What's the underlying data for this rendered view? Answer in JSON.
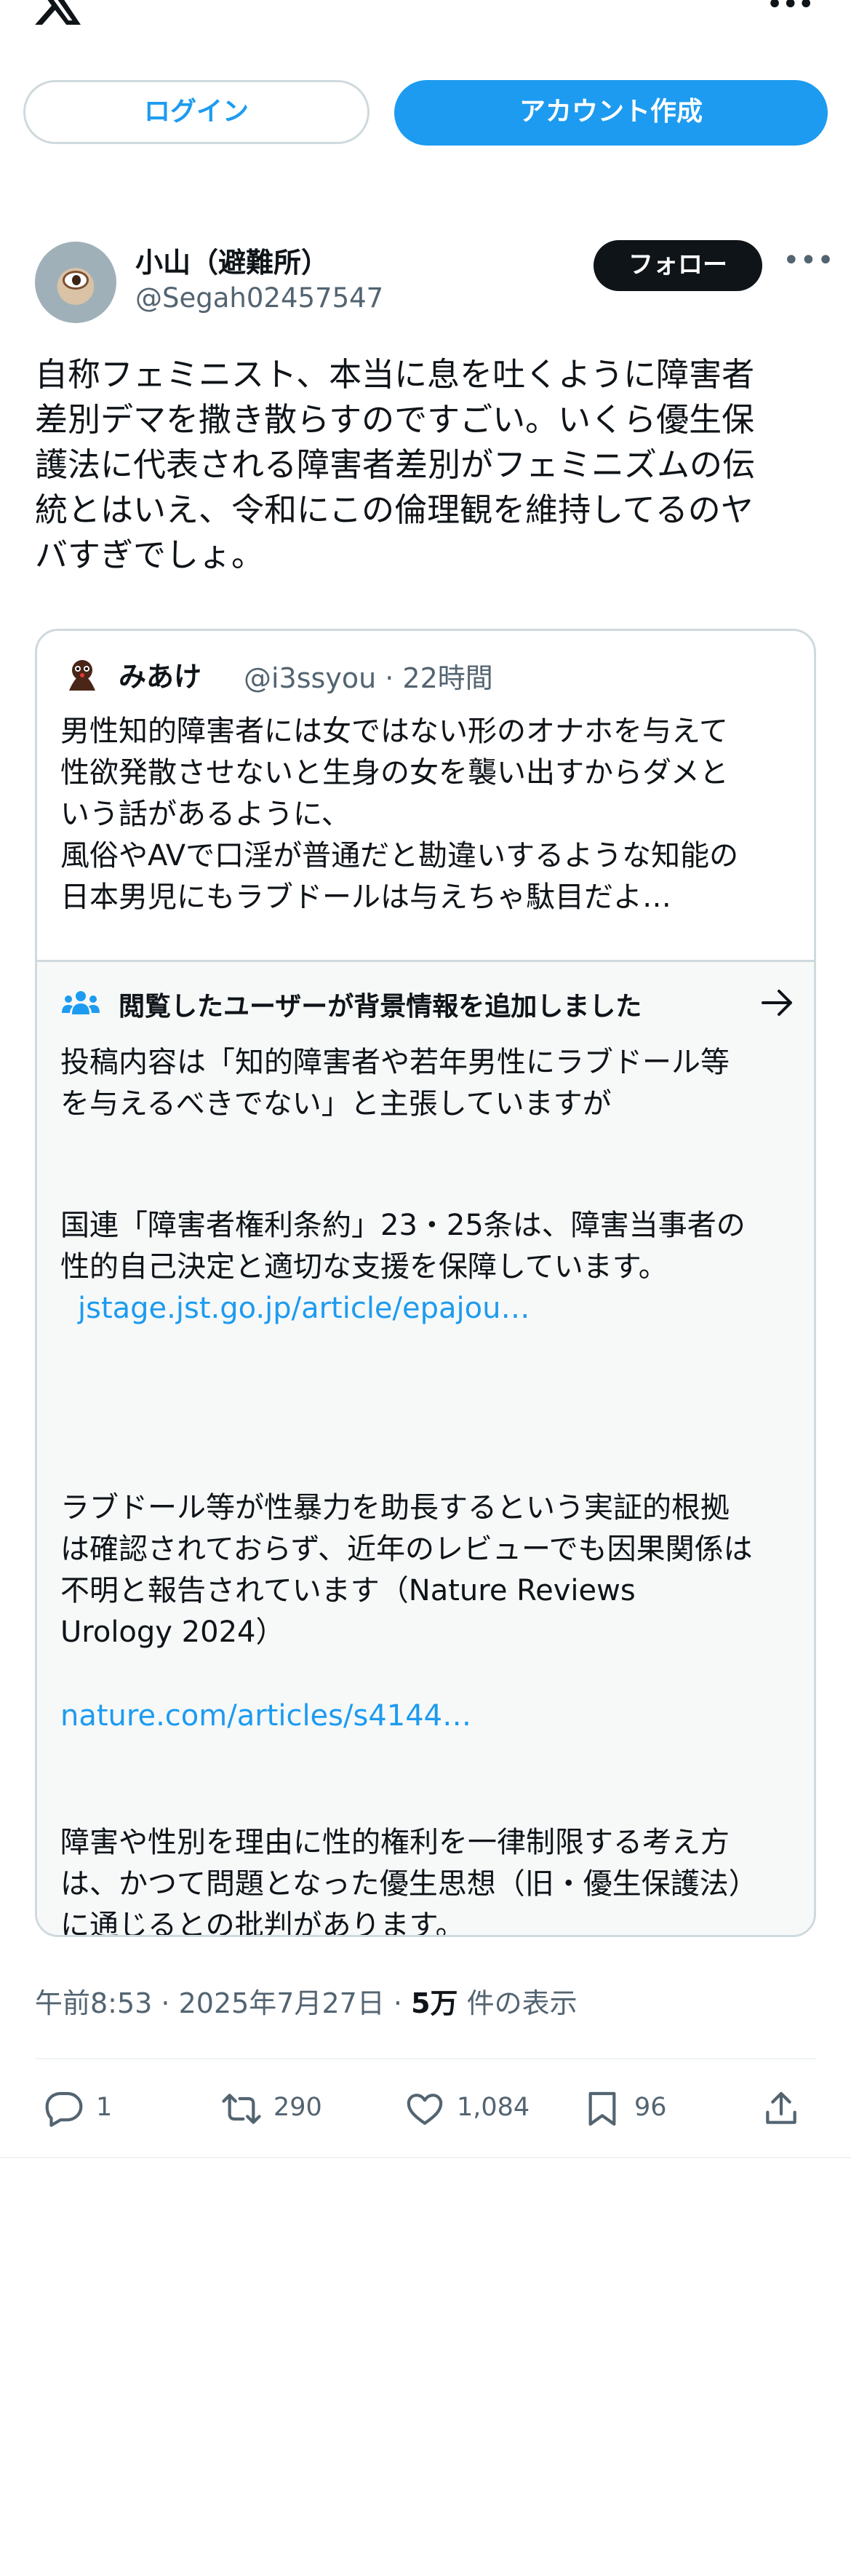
{
  "header": {
    "login_label": "ログイン",
    "signup_label": "アカウント作成"
  },
  "tweet": {
    "author": {
      "display_name": "小山（避難所）",
      "handle": "@Segah02457547"
    },
    "follow_label": "フォロー",
    "text": "自称フェミニスト、本当に息を吐くように障害者\n差別デマを撒き散らすのですごい。いくら優生保\n護法に代表される障害者差別がフェミニズムの伝\n統とはいえ、令和にこの倫理観を維持してるのヤ\nバすぎでしょ。",
    "quote": {
      "name": "みあけ",
      "meta": "@i3ssyou · 22時間",
      "text": "男性知的障害者には女ではない形のオナホを与えて\n性欲発散させないと生身の女を襲い出すからダメと\nいう話があるように、\n風俗やAVで口淫が普通だと勘違いするような知能の\n日本男児にもラブドールは与えちゃ駄目だよ…"
    },
    "community_note": {
      "title": "閲覧したユーザーが背景情報を追加しました",
      "p1": "投稿内容は「知的障害者や若年男性にラブドール等\nを与えるべきでない」と主張していますが",
      "p2": "国連「障害者権利条約」23・25条は、障害当事者の\n性的自己決定と適切な支援を保障しています。",
      "link1": "jstage.jst.go.jp/article/epajou…",
      "p3": "ラブドール等が性暴力を助長するという実証的根拠\nは確認されておらず、近年のレビューでも因果関係は\n不明と報告されています（Nature Reviews\nUrology 2024）",
      "link2": "nature.com/articles/s4144…",
      "p4": "障害や性別を理由に性的権利を一律制限する考え方\nは、かつて問題となった優生思想（旧・優生保護法）\nに通じるとの批判があります。"
    },
    "timestamp": {
      "time": "午前8:53",
      "date": "2025年7月27日",
      "views": "5万",
      "views_label": "件の表示"
    },
    "stats": {
      "replies": "1",
      "retweets": "290",
      "likes": "1,084",
      "bookmarks": "96"
    }
  },
  "icons": [
    "x-logo-icon",
    "more-icon",
    "people-icon",
    "arrow-right-icon",
    "reply-icon",
    "retweet-icon",
    "like-icon",
    "bookmark-icon",
    "share-icon"
  ],
  "colors": {
    "accent": "#1d9bf0",
    "text": "#0f1419",
    "secondary": "#536471",
    "border": "#cfd9de",
    "note_bg": "#f7f9f9"
  }
}
